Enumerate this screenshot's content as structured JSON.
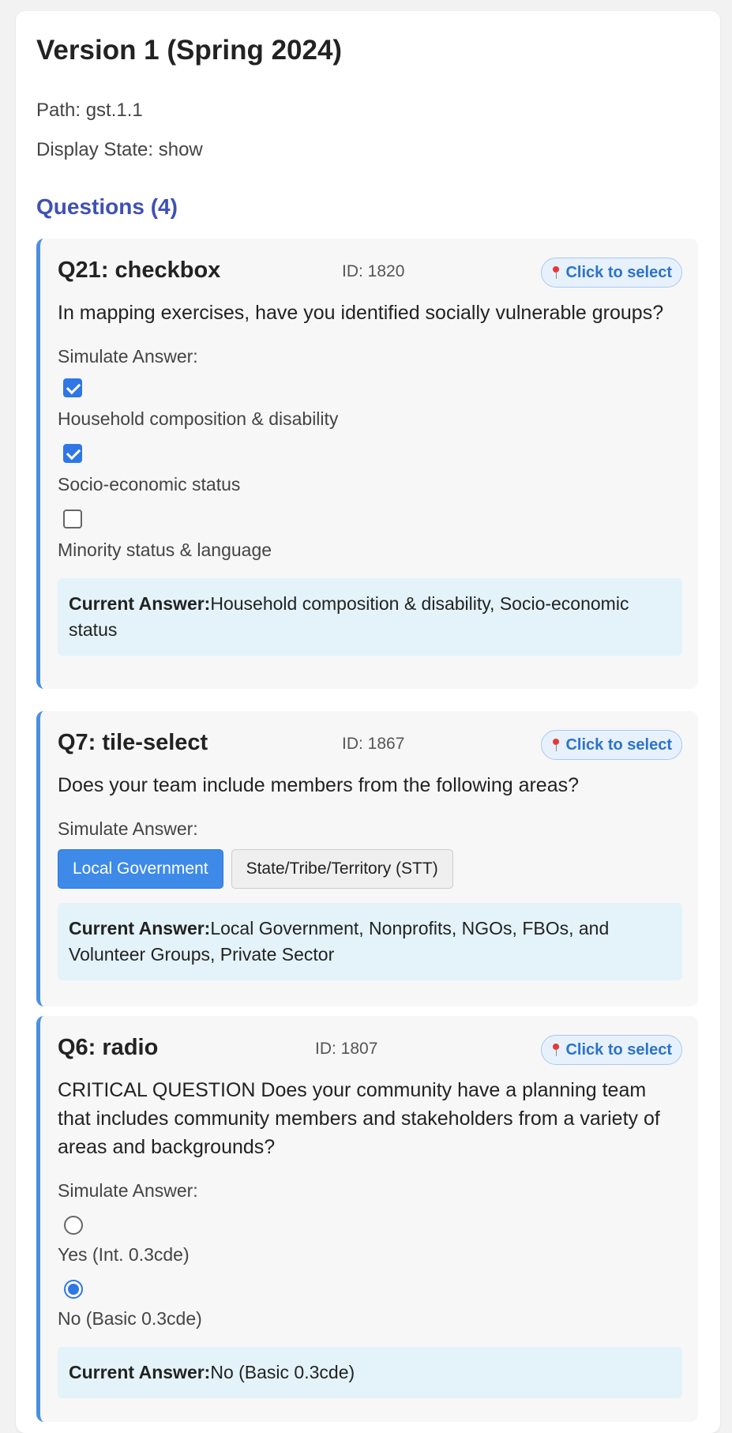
{
  "version": {
    "title": "Version 1 (Spring 2024)",
    "path": "Path: gst.1.1",
    "display_state": "Display State: show"
  },
  "questions_heading": "Questions (4)",
  "select_label": "Click to select",
  "select_icon": "pin-icon",
  "simulate_label": "Simulate Answer:",
  "current_answer_label": "Current Answer:",
  "questions": [
    {
      "title": "Q21: checkbox",
      "id_label": "ID: 1820",
      "type": "checkbox",
      "text": "In mapping exercises, have you identified socially vulnerable groups?",
      "options": [
        {
          "label": "Household composition & disability",
          "checked": true
        },
        {
          "label": "Socio-economic status",
          "checked": true
        },
        {
          "label": "Minority status & language",
          "checked": false
        }
      ],
      "current_answer": "Household composition & disability, Socio-economic status"
    },
    {
      "title": "Q7: tile-select",
      "id_label": "ID: 1867",
      "type": "tile-select",
      "text": "Does your team include members from the following areas?",
      "options": [
        {
          "label": "Local Government",
          "selected": true
        },
        {
          "label": "State/Tribe/Territory (STT)",
          "selected": false
        }
      ],
      "current_answer": "Local Government, Nonprofits, NGOs, FBOs, and Volunteer Groups, Private Sector"
    },
    {
      "title": "Q6: radio",
      "id_label": "ID: 1807",
      "type": "radio",
      "text": "CRITICAL QUESTION Does your community have a planning team that includes community members and stakeholders from a variety of areas and backgrounds?",
      "options": [
        {
          "label": "Yes (Int. 0.3cde)",
          "checked": false
        },
        {
          "label": "No (Basic 0.3cde)",
          "checked": true
        }
      ],
      "current_answer": "No (Basic 0.3cde)"
    }
  ],
  "colors": {
    "accent": "#4a90e2",
    "heading": "#3f51b5",
    "answer_bg": "#e3f3f9",
    "select_text": "#2c73c9"
  }
}
